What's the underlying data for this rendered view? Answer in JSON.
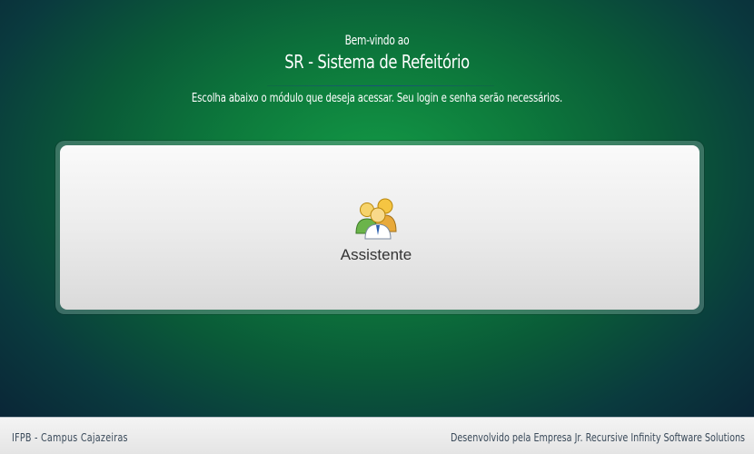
{
  "header": {
    "welcome": "Bem-vindo ao",
    "title": "SR - Sistema de Refeitório",
    "subtitle": "Escolha abaixo o módulo que deseja acessar. Seu login e senha serão necessários."
  },
  "modules": [
    {
      "label": "Assistente",
      "icon": "users-group-icon"
    }
  ],
  "footer": {
    "left": "IFPB - Campus Cajazeiras",
    "right": "Desenvolvido pela Empresa Jr. Recursive Infinity Software Solutions"
  },
  "colors": {
    "background_center": "#139a46",
    "background_edge": "#0a2436",
    "panel": "#ececec",
    "footer": "#ececec",
    "footer_text": "#3a4a5a"
  }
}
